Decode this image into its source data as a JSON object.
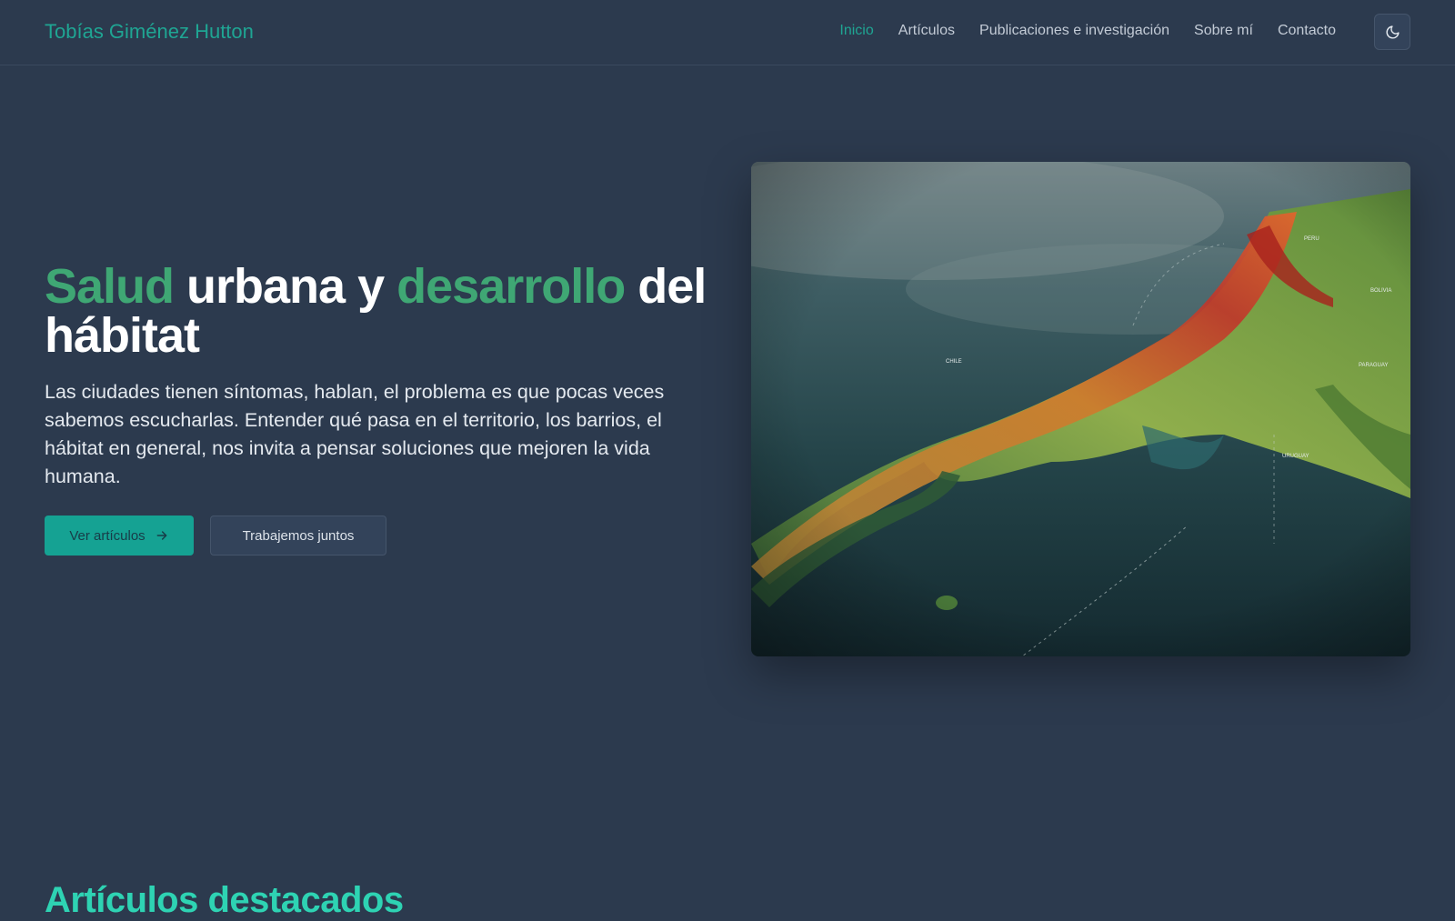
{
  "header": {
    "brand": "Tobías Giménez Hutton",
    "nav": [
      {
        "label": "Inicio",
        "active": true
      },
      {
        "label": "Artículos"
      },
      {
        "label": "Publicaciones e investigación"
      },
      {
        "label": "Sobre mí"
      },
      {
        "label": "Contacto"
      }
    ],
    "theme_toggle_icon": "moon-icon"
  },
  "hero": {
    "title_word_1": "Salud",
    "title_word_2": " urbana y ",
    "title_word_3": "desarrollo",
    "title_word_4": " del hábitat",
    "description": "Las ciudades tienen síntomas, hablan, el problema es que pocas veces sabemos escucharlas. Entender qué pasa en el territorio, los barrios, el hábitat en general, nos invita a pensar soluciones que mejoren la vida humana.",
    "primary_button": "Ver artículos",
    "primary_button_icon": "arrow-right-icon",
    "secondary_button": "Trabajemos juntos",
    "map_labels": {
      "peru": "PERU",
      "bolivia": "BOLIVIA",
      "chile": "CHILE",
      "paraguay": "PARAGUAY",
      "uruguay": "URUGUAY"
    }
  },
  "featured": {
    "title": "Artículos destacados"
  },
  "colors": {
    "background": "#2c3a4e",
    "accent_teal": "#1fa593",
    "accent_green": "#3fa774",
    "section_title": "#2ed3b3"
  }
}
